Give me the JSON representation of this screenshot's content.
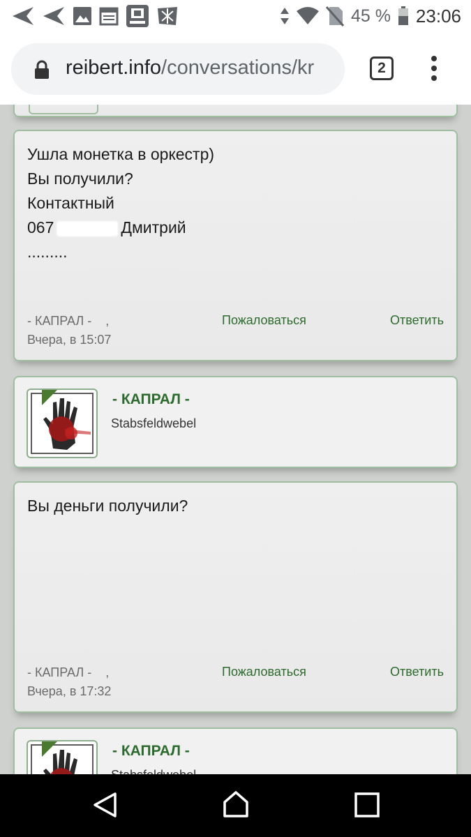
{
  "status_bar": {
    "battery": "45 %",
    "time": "23:06",
    "icons": [
      "navigation-arrow-icon",
      "navigation-arrow-icon",
      "image-icon",
      "calendar-icon",
      "app-icon",
      "app-icon",
      "signal-arrows-icon",
      "wifi-icon",
      "no-sim-icon",
      "battery-icon"
    ]
  },
  "browser": {
    "url_domain": "reibert.info",
    "url_path": "/conversations/kr",
    "tab_count": "2",
    "icons": [
      "lock-icon",
      "tabs-icon",
      "more-vert-icon"
    ]
  },
  "messages": [
    {
      "lines": [
        "Ушла монетка в оркестр)",
        "Вы получили?",
        "Контактный"
      ],
      "phone_prefix": "067",
      "phone_name": "Дмитрий",
      "trailing": ".........",
      "author": "- КАПРАЛ -    ,",
      "time": "Вчера, в 15:07",
      "report": "Пожаловаться",
      "reply": "Ответить"
    },
    {
      "lines": [
        "Вы деньги получили?"
      ],
      "author": "- КАПРАЛ -    ,",
      "time": "Вчера, в 17:32",
      "report": "Пожаловаться",
      "reply": "Ответить"
    }
  ],
  "authors": [
    {
      "name": "- КАПРАЛ -",
      "rank": "Stabsfeldwebel"
    },
    {
      "name": "- КАПРАЛ -",
      "rank": "Stabsfeldwebel"
    }
  ],
  "nav": {
    "icons": [
      "back-icon",
      "home-icon",
      "recents-icon"
    ]
  },
  "colors": {
    "accent_green": "#2d6a2d",
    "card_border": "#9fbe9f",
    "avatar_flag": "#4a7a2f"
  }
}
